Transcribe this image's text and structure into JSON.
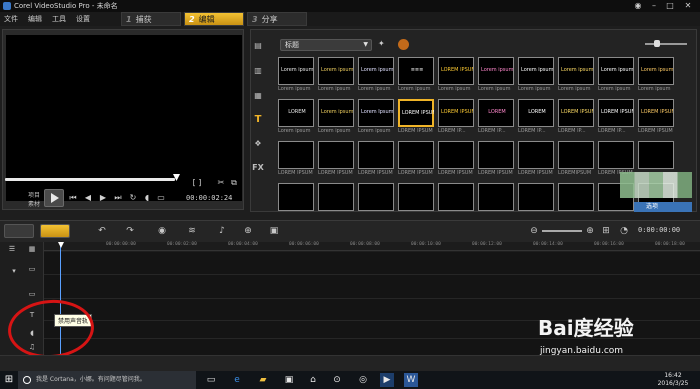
{
  "window": {
    "title": "Corel VideoStudio Pro - 未命名",
    "buttons": [
      "◉",
      "–",
      "□",
      "✕"
    ]
  },
  "menu": [
    "文件",
    "编辑",
    "工具",
    "设置"
  ],
  "steps": [
    {
      "num": "1",
      "label": "捕获"
    },
    {
      "num": "2",
      "label": "编辑"
    },
    {
      "num": "3",
      "label": "分享"
    }
  ],
  "player": {
    "project_label": "项目",
    "clip_label": "素材",
    "timecode": "00:00:02:24",
    "bracket_labels": "[ ]"
  },
  "library": {
    "category": "标题",
    "options_label": "选项",
    "tiles": [
      {
        "glyph": "Lorem ipsum",
        "cap": "Lorem ipsum"
      },
      {
        "glyph": "Lorem ipsum",
        "cap": "Lorem ipsum"
      },
      {
        "glyph": "Lorem ipsum",
        "cap": "Lorem ipsum"
      },
      {
        "glyph": "≡≡≡",
        "cap": "Lorem ipsum"
      },
      {
        "glyph": "LOREM IPSUM",
        "cap": "Lorem ipsum"
      },
      {
        "glyph": "Lorem ipsum",
        "cap": "Lorem ipsum"
      },
      {
        "glyph": "Lorem ipsum",
        "cap": "Lorem ipsum"
      },
      {
        "glyph": "Lorem ipsum",
        "cap": "Lorem ipsum"
      },
      {
        "glyph": "Lorem ipsum",
        "cap": "Lorem ipsum"
      },
      {
        "glyph": "Lorem ipsum",
        "cap": "Lorem ipsum"
      },
      {
        "glyph": "LOREM",
        "cap": "Lorem ipsum"
      },
      {
        "glyph": "Lorem ipsum",
        "cap": "Lorem ipsum"
      },
      {
        "glyph": "Lorem Ipsum",
        "cap": "Lorem ipsum"
      },
      {
        "glyph": "LOREM IPSUM",
        "cap": "LOREM IPSUM"
      },
      {
        "glyph": "LOREM IPSUM",
        "cap": "LOREM IP..."
      },
      {
        "glyph": "LOREM",
        "cap": "LOREM IP..."
      },
      {
        "glyph": "LOREM",
        "cap": "LOREM IP..."
      },
      {
        "glyph": "LOREM IPSUM",
        "cap": "LOREM IP..."
      },
      {
        "glyph": "LOREM IPSUM",
        "cap": "LOREM IP..."
      },
      {
        "glyph": "LOREM IPSUM",
        "cap": "LOREM IPSUM"
      },
      {
        "glyph": "",
        "cap": "LOREM IPSUM"
      },
      {
        "glyph": "",
        "cap": "LOREM IPSUM"
      },
      {
        "glyph": "",
        "cap": "LOREM IPSUM"
      },
      {
        "glyph": "",
        "cap": "LOREM IPSUM"
      },
      {
        "glyph": "",
        "cap": "LOREM IPSUM"
      },
      {
        "glyph": "",
        "cap": "LOREM IPSUM"
      },
      {
        "glyph": "",
        "cap": "LOREM IPSUM"
      },
      {
        "glyph": "",
        "cap": "LOREMIPSUM"
      },
      {
        "glyph": "",
        "cap": "LOREM IPSUM"
      },
      {
        "glyph": "",
        "cap": ""
      },
      {
        "glyph": "",
        "cap": ""
      },
      {
        "glyph": "",
        "cap": ""
      },
      {
        "glyph": "",
        "cap": ""
      },
      {
        "glyph": "",
        "cap": ""
      },
      {
        "glyph": "",
        "cap": ""
      },
      {
        "glyph": "",
        "cap": ""
      },
      {
        "glyph": "",
        "cap": ""
      },
      {
        "glyph": "",
        "cap": ""
      },
      {
        "glyph": "",
        "cap": ""
      },
      {
        "glyph": "",
        "cap": ""
      }
    ]
  },
  "timeline": {
    "timecode": "0:00:00:00",
    "ruler": [
      "00:00:00:00",
      "00:00:02:00",
      "00:00:04:00",
      "00:00:06:00",
      "00:00:08:00",
      "00:00:10:00",
      "00:00:12:00",
      "00:00:14:00",
      "00:00:16:00",
      "00:00:18:00"
    ],
    "tooltip": "禁用声音轨"
  },
  "taskbar": {
    "search_placeholder": "我是 Cortana，小娜。有问题尽管问我。",
    "time": "16:42",
    "date": "2016/3/25"
  },
  "watermark": {
    "logo": "Bai度经验",
    "url": "jingyan.baidu.com"
  },
  "colors": {
    "accent": "#f0b428",
    "selection_blue": "#3a73b6",
    "annotation_red": "#d61414"
  }
}
